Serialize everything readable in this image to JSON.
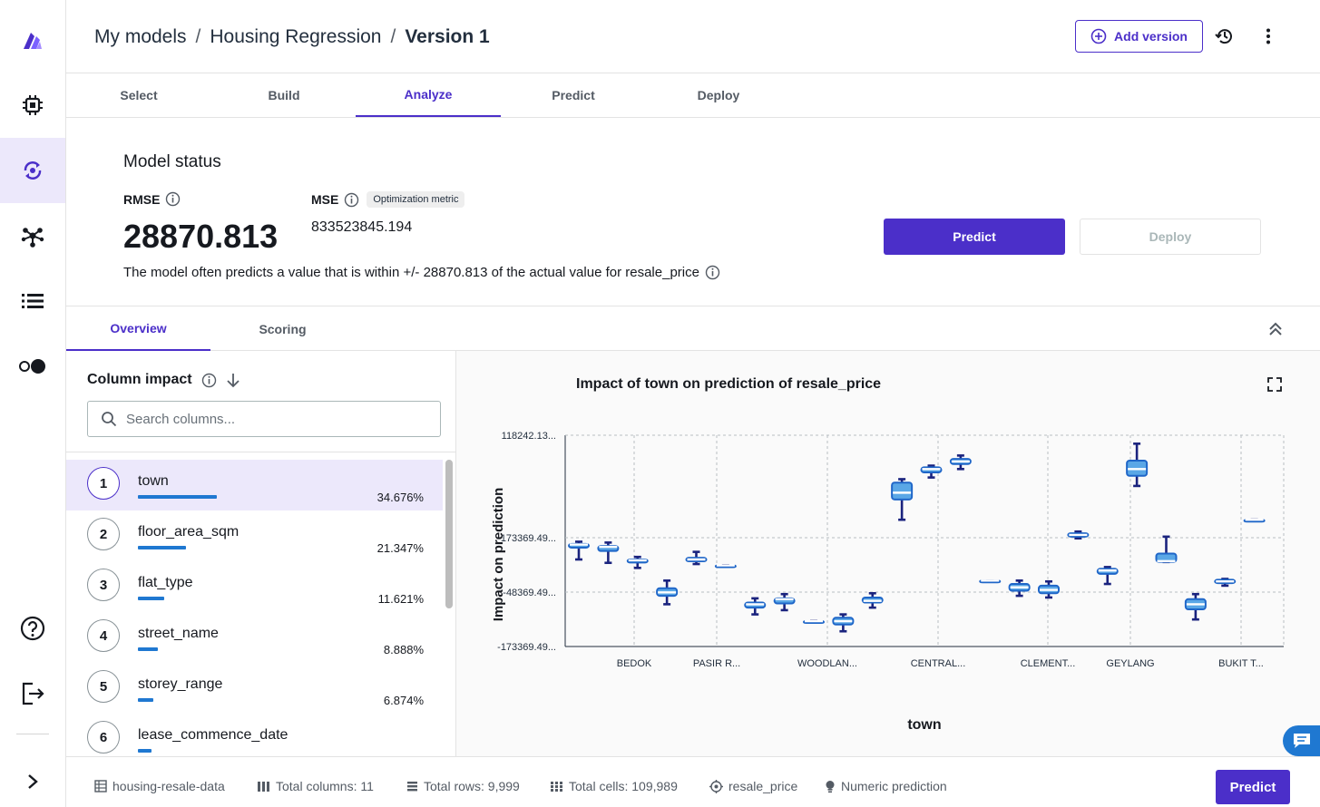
{
  "header": {
    "breadcrumb": [
      "My models",
      "Housing Regression",
      "Version 1"
    ],
    "add_version_label": "Add version"
  },
  "tabs": [
    {
      "label": "Select"
    },
    {
      "label": "Build"
    },
    {
      "label": "Analyze"
    },
    {
      "label": "Predict"
    },
    {
      "label": "Deploy"
    }
  ],
  "status": {
    "title": "Model status",
    "rmse_label": "RMSE",
    "rmse_value": "28870.813",
    "mse_label": "MSE",
    "mse_badge": "Optimization metric",
    "mse_value": "833523845.194",
    "description": "The model often predicts a value that is within +/- 28870.813 of the actual value for resale_price",
    "predict_label": "Predict",
    "deploy_label": "Deploy"
  },
  "subtabs": [
    {
      "label": "Overview"
    },
    {
      "label": "Scoring"
    }
  ],
  "impact": {
    "title": "Column impact",
    "search_placeholder": "Search columns...",
    "columns": [
      {
        "rank": "1",
        "name": "town",
        "pct": "34.676%",
        "share": 0.34676
      },
      {
        "rank": "2",
        "name": "floor_area_sqm",
        "pct": "21.347%",
        "share": 0.21347
      },
      {
        "rank": "3",
        "name": "flat_type",
        "pct": "11.621%",
        "share": 0.11621
      },
      {
        "rank": "4",
        "name": "street_name",
        "pct": "8.888%",
        "share": 0.08888
      },
      {
        "rank": "5",
        "name": "storey_range",
        "pct": "6.874%",
        "share": 0.06874
      },
      {
        "rank": "6",
        "name": "lease_commence_date",
        "pct": "",
        "share": 0.06
      }
    ]
  },
  "chart_data": {
    "type": "box",
    "title": "Impact of town on prediction of resale_price",
    "xlabel": "town",
    "ylabel": "Impact on prediction",
    "y_tick_labels": [
      "118242.13...",
      "-173369.49...",
      "-48369.49...",
      "-173369.49..."
    ],
    "x_tick_labels": [
      "BEDOK",
      "PASIR R...",
      "WOODLAN...",
      "CENTRAL...",
      "CLEMENT...",
      "GEYLANG",
      "BUKIT T..."
    ],
    "grid": true,
    "boxes": [
      {
        "min": 0.735,
        "q1": 0.665,
        "median": 0.647,
        "q3": 0.643,
        "max": 0.63
      },
      {
        "min": 0.755,
        "q1": 0.685,
        "median": 0.66,
        "q3": 0.655,
        "max": 0.635
      },
      {
        "min": 0.785,
        "q1": 0.753,
        "median": 0.74,
        "q3": 0.735,
        "max": 0.72
      },
      {
        "min": 1.0,
        "q1": 0.95,
        "median": 0.93,
        "q3": 0.905,
        "max": 0.86
      },
      {
        "min": 0.762,
        "q1": 0.746,
        "median": 0.735,
        "q3": 0.725,
        "max": 0.69
      },
      {
        "min": 0.77,
        "q1": 0.77,
        "median": 0.77,
        "q3": 0.77,
        "max": 0.77
      },
      {
        "min": 1.06,
        "q1": 1.02,
        "median": 1.0,
        "q3": 0.99,
        "max": 0.965
      },
      {
        "min": 1.035,
        "q1": 0.995,
        "median": 0.97,
        "q3": 0.965,
        "max": 0.94
      },
      {
        "min": 1.1,
        "q1": 1.1,
        "median": 1.1,
        "q3": 1.1,
        "max": 1.1
      },
      {
        "min": 1.16,
        "q1": 1.12,
        "median": 1.1,
        "q3": 1.08,
        "max": 1.06
      },
      {
        "min": 1.02,
        "q1": 0.99,
        "median": 0.98,
        "q3": 0.96,
        "max": 0.935
      },
      {
        "min": 0.5,
        "q1": 0.38,
        "median": 0.34,
        "q3": 0.28,
        "max": 0.26
      },
      {
        "min": 0.25,
        "q1": 0.22,
        "median": 0.2,
        "q3": 0.19,
        "max": 0.18
      },
      {
        "min": 0.2,
        "q1": 0.17,
        "median": 0.155,
        "q3": 0.14,
        "max": 0.12
      },
      {
        "min": 0.86,
        "q1": 0.86,
        "median": 0.86,
        "q3": 0.86,
        "max": 0.86
      },
      {
        "min": 0.95,
        "q1": 0.92,
        "median": 0.9,
        "q3": 0.88,
        "max": 0.86
      },
      {
        "min": 0.96,
        "q1": 0.935,
        "median": 0.915,
        "q3": 0.89,
        "max": 0.865
      },
      {
        "min": 0.61,
        "q1": 0.6,
        "median": 0.59,
        "q3": 0.58,
        "max": 0.57
      },
      {
        "min": 0.88,
        "q1": 0.82,
        "median": 0.8,
        "q3": 0.79,
        "max": 0.78
      },
      {
        "min": 0.3,
        "q1": 0.24,
        "median": 0.2,
        "q3": 0.15,
        "max": 0.05
      },
      {
        "min": 0.75,
        "q1": 0.75,
        "median": 0.745,
        "q3": 0.7,
        "max": 0.6
      },
      {
        "min": 1.09,
        "q1": 1.03,
        "median": 1.0,
        "q3": 0.97,
        "max": 0.94
      },
      {
        "min": 0.89,
        "q1": 0.875,
        "median": 0.865,
        "q3": 0.855,
        "max": 0.85
      },
      {
        "min": 0.5,
        "q1": 0.5,
        "median": 0.5,
        "q3": 0.5,
        "max": 0.5
      }
    ]
  },
  "footer": {
    "dataset": "housing-resale-data",
    "columns": "Total columns: 11",
    "rows": "Total rows: 9,999",
    "cells": "Total cells: 109,989",
    "target": "resale_price",
    "problem": "Numeric prediction",
    "predict_label": "Predict"
  },
  "colors": {
    "accent": "#4b2fc9",
    "box_fill": "#5aa7e6",
    "box_stroke": "#1f66c8",
    "whisker": "#1a237e",
    "bar": "#1f78d1"
  },
  "icons": [
    "logo-icon",
    "chip-icon",
    "analyze-icon",
    "network-icon",
    "list-icon",
    "toggle-icon",
    "help-icon",
    "logout-icon",
    "expand-rail-icon",
    "add-circle-icon",
    "history-icon",
    "more-vertical-icon",
    "info-icon",
    "sort-down-icon",
    "search-icon",
    "collapse-up-icon",
    "fullscreen-icon",
    "feedback-icon",
    "table-icon",
    "columns-icon",
    "rows-icon",
    "cells-icon",
    "target-icon",
    "bulb-icon"
  ]
}
